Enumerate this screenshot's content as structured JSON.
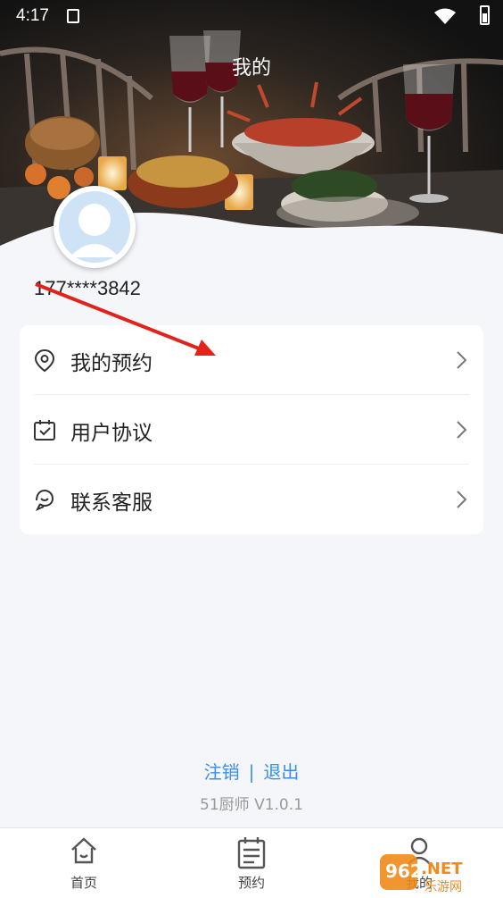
{
  "status_bar": {
    "time": "4:17"
  },
  "header": {
    "title": "我的"
  },
  "profile": {
    "phone": "177****3842"
  },
  "menu": [
    {
      "label": "我的预约",
      "icon": "location-pin-icon"
    },
    {
      "label": "用户协议",
      "icon": "clipboard-check-icon"
    },
    {
      "label": "联系客服",
      "icon": "customer-service-icon"
    }
  ],
  "footer": {
    "cancel_account": "注销",
    "separator": "|",
    "logout": "退出",
    "version": "51厨师 V1.0.1"
  },
  "tabbar": [
    {
      "label": "首页",
      "icon": "home-icon"
    },
    {
      "label": "预约",
      "icon": "calendar-icon"
    },
    {
      "label": "我的",
      "icon": "user-icon"
    }
  ],
  "watermark": {
    "text_main": "962.NET",
    "text_sub": "乐游网"
  },
  "colors": {
    "accent": "#3b8ee6",
    "background": "#f4f6f9",
    "annotation_arrow": "#e0241b"
  }
}
